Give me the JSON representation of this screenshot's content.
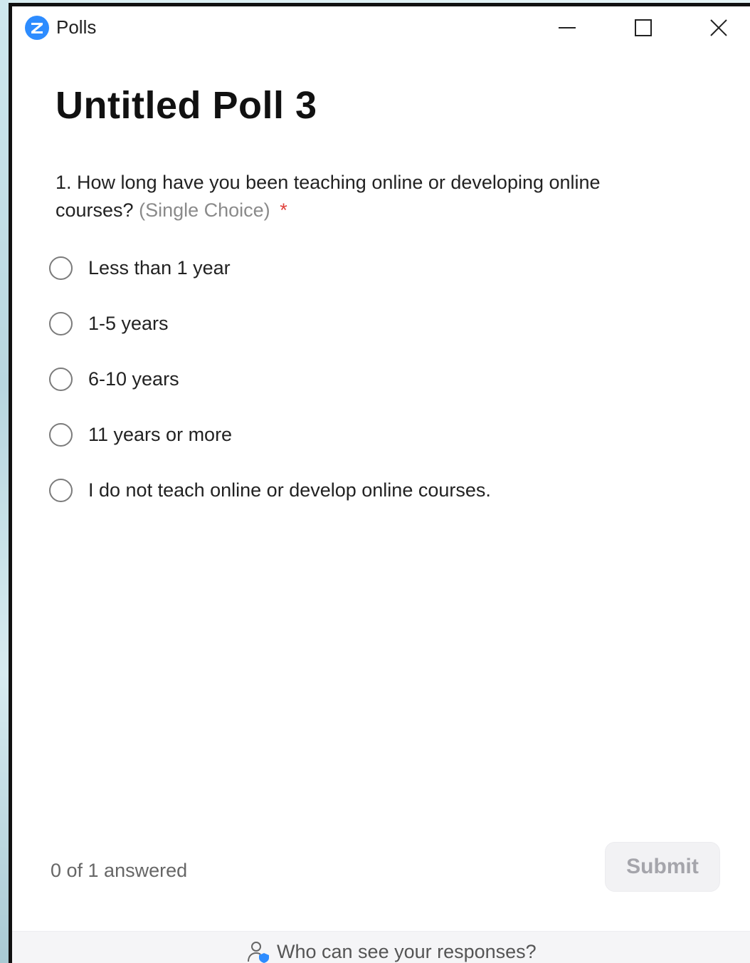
{
  "window": {
    "title": "Polls"
  },
  "poll": {
    "title": "Untitled Poll 3",
    "question": {
      "text": "1. How long have you been teaching online or developing online courses?",
      "type_hint": "(Single Choice)",
      "required_marker": "*"
    },
    "options": [
      {
        "label": "Less than 1 year"
      },
      {
        "label": "1-5 years"
      },
      {
        "label": "6-10 years"
      },
      {
        "label": "11 years or more"
      },
      {
        "label": "I do not teach online or develop online courses."
      }
    ]
  },
  "footer": {
    "answered_status": "0 of 1 answered",
    "submit_label": "Submit",
    "privacy_link": "Who can see your responses?"
  },
  "colors": {
    "brand": "#2d8cff",
    "required": "#e0413c",
    "submit_disabled_bg": "#f2f2f4"
  },
  "icons": {
    "app": "zoom-logo-icon",
    "minimize": "minimize-icon",
    "maximize": "maximize-icon",
    "close": "close-icon",
    "privacy": "user-shield-icon"
  }
}
